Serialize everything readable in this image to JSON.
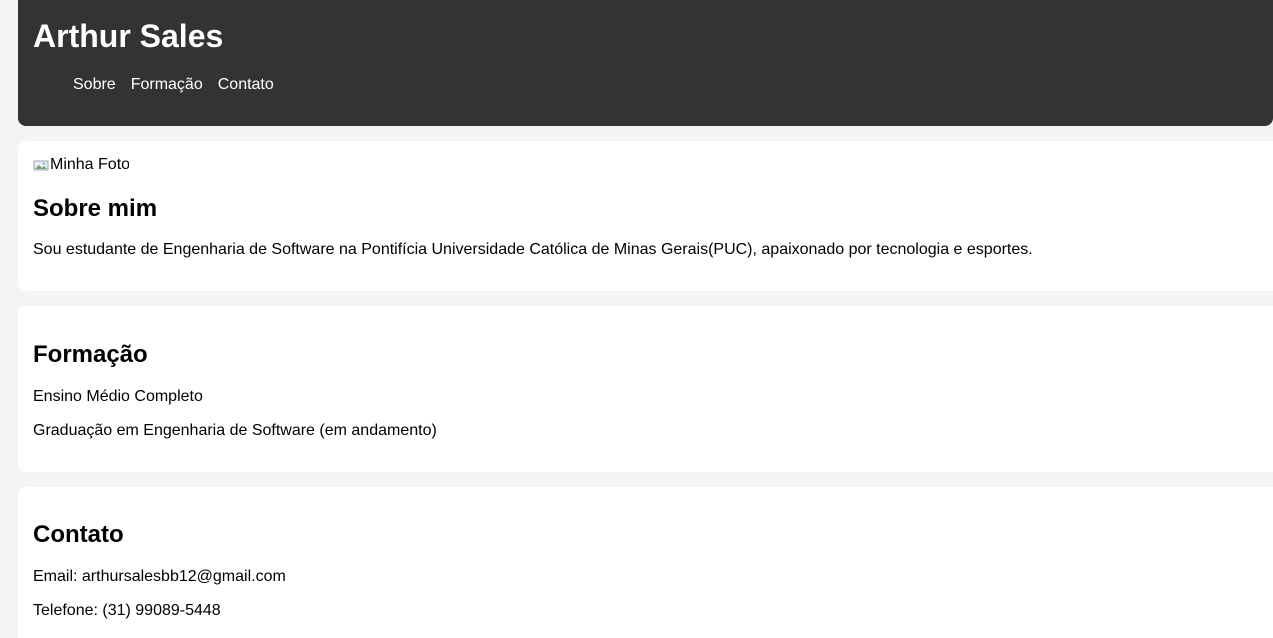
{
  "header": {
    "title": "Arthur Sales",
    "nav": [
      "Sobre",
      "Formação",
      "Contato"
    ]
  },
  "about": {
    "photo_alt": "Minha Foto",
    "heading": "Sobre mim",
    "text": "Sou estudante de Engenharia de Software na Pontifícia Universidade Católica de Minas Gerais(PUC), apaixonado por tecnologia e esportes."
  },
  "education": {
    "heading": "Formação",
    "items": [
      "Ensino Médio Completo",
      "Graduação em Engenharia de Software (em andamento)"
    ]
  },
  "contact": {
    "heading": "Contato",
    "email": "Email: arthursalesbb12@gmail.com",
    "phone": "Telefone: (31) 99089-5448"
  },
  "colors": {
    "header_bg": "#333333",
    "page_bg": "#f4f4f4",
    "card_bg": "#ffffff"
  },
  "icons": {
    "photo": "broken-image-icon"
  }
}
